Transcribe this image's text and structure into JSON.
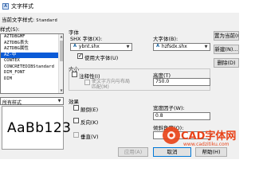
{
  "window": {
    "title": "文字样式",
    "app_icon": "A"
  },
  "current_style": {
    "label": "当前文字样式:",
    "value": "Standard"
  },
  "styles": {
    "label": "样式(S):",
    "items": [
      "AZTDBGMF",
      "AZTDBG表头",
      "AZTDBG属性",
      "AZ-中",
      "CONTEX",
      "CONCRETEDIBStandard",
      "DIM_FONT",
      "DIM"
    ],
    "selected_index": 3,
    "filter_value": "所有样式"
  },
  "preview": {
    "text": "AaBb123"
  },
  "font": {
    "group_label": "字体",
    "shx_label": "SHX 字体(X):",
    "shx_value": "ybnt.shx",
    "big_label": "大字体(B):",
    "big_value": "hzfsdx.shx",
    "use_big_label": "使用大字体(U)",
    "use_big_checked": true
  },
  "size": {
    "group_label": "大小",
    "annotative_label": "注释性(I)",
    "match_label": "使文字方向与布局匹配(M)",
    "height_label": "高度(T)",
    "height_value": "750.0"
  },
  "effects": {
    "group_label": "效果",
    "upside_label": "颠倒(E)",
    "backwards_label": "反向(K)",
    "vertical_label": "垂直(V)",
    "width_label": "宽度因子(W):",
    "width_value": "0.8",
    "oblique_label": "倾斜角度(O):"
  },
  "buttons": {
    "set_current": "置为当前(C)",
    "new": "新建(N)...",
    "delete": "删除(D)",
    "apply": "应用(A)",
    "cancel": "取消",
    "help": "帮助(H)"
  },
  "watermark": {
    "brand": "CAD字体网",
    "url": "www.cadzitiku.com",
    "color": "#e8441a"
  }
}
